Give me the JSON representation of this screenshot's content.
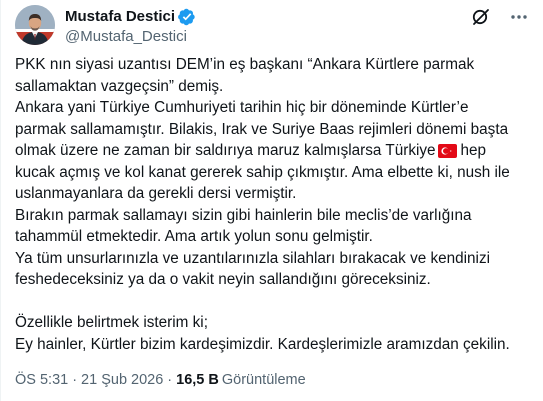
{
  "author": {
    "display_name": "Mustafa Destici",
    "handle": "@Mustafa_Destici",
    "verified": true,
    "verified_color": "#1d9bf0"
  },
  "icons": {
    "verified": "verified-badge-icon",
    "grok": "grok-icon",
    "more": "more-dots-icon",
    "flag": "turkey-flag-icon"
  },
  "tweet": {
    "lines": [
      "PKK nın siyasi uzantısı DEM’in eş başkanı “Ankara Kürtlere parmak",
      "sallamaktan vazgeçsin” demiş.",
      "Ankara yani Türkiye Cumhuriyeti tarihin hiç bir döneminde Kürtler’e",
      "parmak sallamamıştır. Bilakis, Irak ve Suriye Baas rejimleri dönemi başta",
      "olmak üzere ne zaman bir saldırıya maruz kalmışlarsa Türkiye",
      "kucak açmış ve kol kanat gererek sahip çıkmıştır. Ama elbette ki, nush ile",
      "uslanmayanlara da gerekli dersi vermiştir.",
      "Bırakın parmak sallamayı sizin gibi hainlerin bile meclis’de varlığına",
      "tahammül etmektedir. Ama artık yolun sonu gelmiştir.",
      "Ya tüm unsurlarınızla ve uzantılarınızla silahları bırakacak ve kendinizi",
      "feshedeceksiniz ya da o vakit neyin sallandığını göreceksiniz.",
      "",
      "Özellikle belirtmek isterim ki;",
      "Ey hainler, Kürtler bizim kardeşimizdir. Kardeşlerimizle aramızdan çekilin."
    ],
    "line5_after_flag": "hep"
  },
  "meta": {
    "time": "ÖS 5:31",
    "date": "21 Şub 2026",
    "separator": "·",
    "views_count": "16,5 B",
    "views_label": "Görüntüleme"
  },
  "colors": {
    "text": "#0f1419",
    "secondary": "#536471",
    "flag_red": "#e30a17"
  }
}
